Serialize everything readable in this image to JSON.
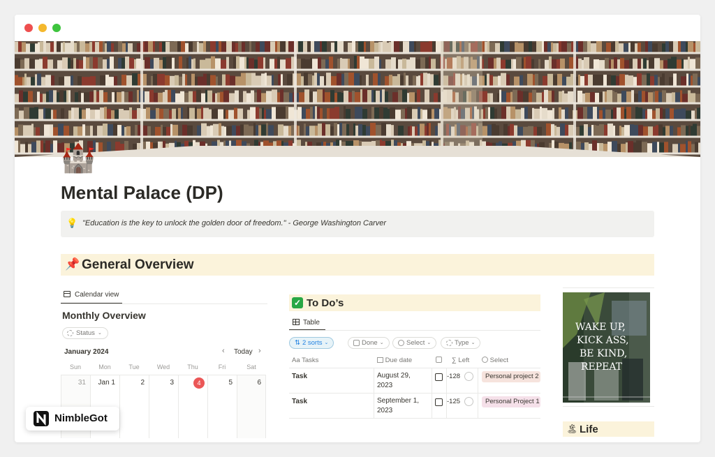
{
  "page": {
    "icon": "castle-icon",
    "icon_glyph": "🏰",
    "title": "Mental Palace (DP)",
    "callout": {
      "icon_glyph": "💡",
      "quote": "\"Education is the key to unlock the golden door of freedom.\" - George Washington Carver"
    }
  },
  "overview": {
    "icon_glyph": "📌",
    "heading": "General Overview"
  },
  "calendar": {
    "view_tab": "Calendar view",
    "title": "Monthly Overview",
    "status_filter": "Status",
    "month_label": "January 2024",
    "today_label": "Today",
    "prev_glyph": "‹",
    "next_glyph": "›",
    "weekdays": [
      "Sun",
      "Mon",
      "Tue",
      "Wed",
      "Thu",
      "Fri",
      "Sat"
    ],
    "days": [
      "31",
      "Jan 1",
      "2",
      "3",
      "4",
      "5",
      "6"
    ],
    "today_index": 4
  },
  "todos": {
    "heading_glyph": "✓",
    "heading": "To Do’s",
    "view_tab": "Table",
    "chips": {
      "sorts": "2 sorts",
      "done": "Done",
      "select": "Select",
      "type": "Type"
    },
    "columns": {
      "tasks": "Tasks",
      "tasks_prefix": "Aa",
      "due": "Due date",
      "left": "Left",
      "select": "Select"
    },
    "rows": [
      {
        "task": "Task",
        "due_line1": "August 29,",
        "due_line2": "2023",
        "done": false,
        "left": "-128",
        "select": "Personal project 2",
        "select_color": "#f6e3dd"
      },
      {
        "task": "Task",
        "due_line1": "September 1,",
        "due_line2": "2023",
        "done": false,
        "left": "-125",
        "select": "Personal Project 1",
        "select_color": "#f5e0e9"
      }
    ]
  },
  "poster": {
    "lines": [
      "WAKE UP,",
      "KICK ASS,",
      "BE KIND,",
      "REPEAT"
    ]
  },
  "life": {
    "icon_glyph": "🏝",
    "heading": "Life"
  },
  "branding": {
    "logo": "N",
    "name": "NimbleGot"
  },
  "colors": {
    "accent_blue": "#2383e2",
    "today_red": "#eb5757",
    "heading_bg": "#fbf3db",
    "callout_bg": "#f1f1ef"
  }
}
